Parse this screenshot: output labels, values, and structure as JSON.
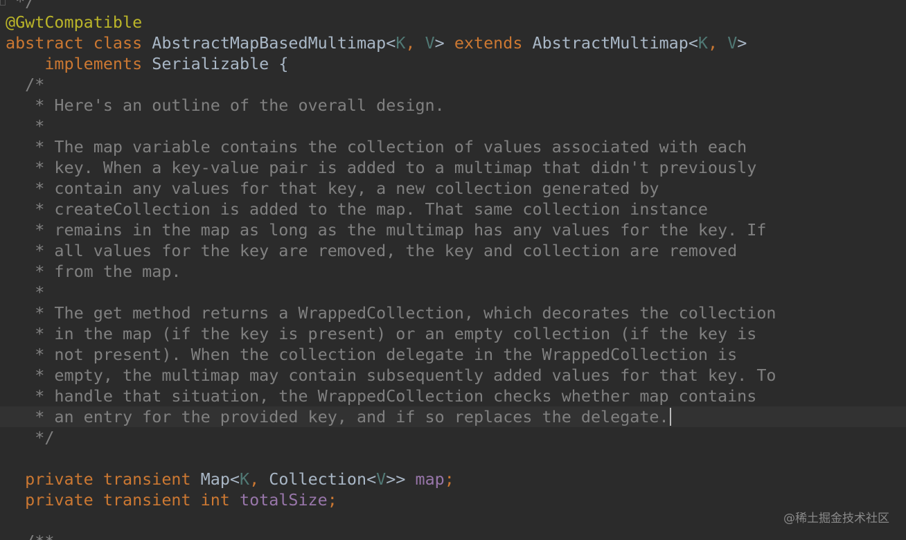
{
  "theme": {
    "background": "#2b2b2b",
    "current_line": "#323232",
    "keyword": "#cc7832",
    "annotation": "#bbb529",
    "plain": "#a9b7c6",
    "type_param": "#507874",
    "field": "#9876aa",
    "comment": "#808080"
  },
  "editor": {
    "caret_line": 20,
    "lines": [
      [
        {
          "t": " */",
          "k": "comment"
        }
      ],
      [
        {
          "t": "@GwtCompatible",
          "k": "annotation"
        }
      ],
      [
        {
          "t": "abstract class ",
          "k": "keyword"
        },
        {
          "t": "AbstractMapBasedMultimap<",
          "k": "plain"
        },
        {
          "t": "K",
          "k": "typeparam"
        },
        {
          "t": ", ",
          "k": "keyword"
        },
        {
          "t": "V",
          "k": "typeparam"
        },
        {
          "t": "> ",
          "k": "plain"
        },
        {
          "t": "extends ",
          "k": "keyword"
        },
        {
          "t": "AbstractMultimap<",
          "k": "plain"
        },
        {
          "t": "K",
          "k": "typeparam"
        },
        {
          "t": ", ",
          "k": "keyword"
        },
        {
          "t": "V",
          "k": "typeparam"
        },
        {
          "t": ">",
          "k": "plain"
        }
      ],
      [
        {
          "t": "    ",
          "k": "plain"
        },
        {
          "t": "implements ",
          "k": "keyword"
        },
        {
          "t": "Serializable {",
          "k": "plain"
        }
      ],
      [
        {
          "t": "  /*",
          "k": "comment"
        }
      ],
      [
        {
          "t": "   * Here's an outline of the overall design.",
          "k": "comment"
        }
      ],
      [
        {
          "t": "   *",
          "k": "comment"
        }
      ],
      [
        {
          "t": "   * The map variable contains the collection of values associated with each",
          "k": "comment"
        }
      ],
      [
        {
          "t": "   * key. When a key-value pair is added to a multimap that didn't previously",
          "k": "comment"
        }
      ],
      [
        {
          "t": "   * contain any values for that key, a new collection generated by",
          "k": "comment"
        }
      ],
      [
        {
          "t": "   * createCollection is added to the map. That same collection instance",
          "k": "comment"
        }
      ],
      [
        {
          "t": "   * remains in the map as long as the multimap has any values for the key. If",
          "k": "comment"
        }
      ],
      [
        {
          "t": "   * all values for the key are removed, the key and collection are removed",
          "k": "comment"
        }
      ],
      [
        {
          "t": "   * from the map.",
          "k": "comment"
        }
      ],
      [
        {
          "t": "   *",
          "k": "comment"
        }
      ],
      [
        {
          "t": "   * The get method returns a WrappedCollection, which decorates the collection",
          "k": "comment"
        }
      ],
      [
        {
          "t": "   * in the map (if the key is present) or an empty collection (if the key is",
          "k": "comment"
        }
      ],
      [
        {
          "t": "   * not present). When the collection delegate in the WrappedCollection is",
          "k": "comment"
        }
      ],
      [
        {
          "t": "   * empty, the multimap may contain subsequently added values for that key. To",
          "k": "comment"
        }
      ],
      [
        {
          "t": "   * handle that situation, the WrappedCollection checks whether map contains",
          "k": "comment"
        }
      ],
      [
        {
          "t": "   * an entry for the provided key, and if so replaces the delegate.",
          "k": "comment"
        }
      ],
      [
        {
          "t": "   */",
          "k": "comment"
        }
      ],
      [],
      [
        {
          "t": "  private transient ",
          "k": "keyword"
        },
        {
          "t": "Map<",
          "k": "plain"
        },
        {
          "t": "K",
          "k": "typeparam"
        },
        {
          "t": ", ",
          "k": "keyword"
        },
        {
          "t": "Collection<",
          "k": "plain"
        },
        {
          "t": "V",
          "k": "typeparam"
        },
        {
          "t": ">> ",
          "k": "plain"
        },
        {
          "t": "map",
          "k": "field"
        },
        {
          "t": ";",
          "k": "keyword"
        }
      ],
      [
        {
          "t": "  private transient int ",
          "k": "keyword"
        },
        {
          "t": "totalSize",
          "k": "field"
        },
        {
          "t": ";",
          "k": "keyword"
        }
      ],
      [],
      [
        {
          "t": "  /**",
          "k": "comment"
        }
      ]
    ]
  },
  "watermark": {
    "text": "@稀土掘金技术社区"
  }
}
